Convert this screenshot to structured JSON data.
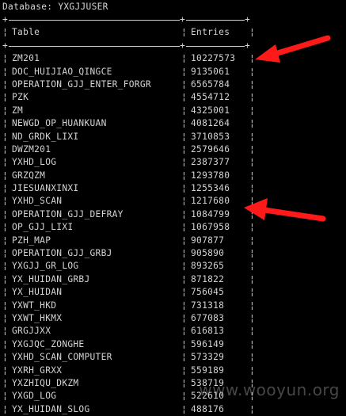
{
  "console": {
    "database_label": "Database: YXGJJUSER"
  },
  "table": {
    "headers": {
      "table": "Table",
      "entries": "Entries"
    },
    "rows": [
      {
        "table": "ZM201",
        "entries": "10227573"
      },
      {
        "table": "DOC_HUIJIAO_QINGCE",
        "entries": "9135061"
      },
      {
        "table": "OPERATION_GJJ_ENTER_FORGR",
        "entries": "6565784"
      },
      {
        "table": "PZK",
        "entries": "4554712"
      },
      {
        "table": "ZM",
        "entries": "4325001"
      },
      {
        "table": "NEWGD_OP_HUANKUAN",
        "entries": "4081264"
      },
      {
        "table": "ND_GRDK_LIXI",
        "entries": "3710853"
      },
      {
        "table": "DWZM201",
        "entries": "2579646"
      },
      {
        "table": "YXHD_LOG",
        "entries": "2387377"
      },
      {
        "table": "GRZQZM",
        "entries": "1293780"
      },
      {
        "table": "JIESUANXINXI",
        "entries": "1255346"
      },
      {
        "table": "YXHD_SCAN",
        "entries": "1217680"
      },
      {
        "table": "OPERATION_GJJ_DEFRAY",
        "entries": "1084799"
      },
      {
        "table": "OP_GJJ_LIXI",
        "entries": "1067958"
      },
      {
        "table": "PZH_MAP",
        "entries": "907877"
      },
      {
        "table": "OPERATION_GJJ_GRBJ",
        "entries": "905890"
      },
      {
        "table": "YXGJJ_GR_LOG",
        "entries": "893265"
      },
      {
        "table": "YX_HUIDAN_GRBJ",
        "entries": "871822"
      },
      {
        "table": "YX_HUIDAN",
        "entries": "756045"
      },
      {
        "table": "YXWT_HKD",
        "entries": "731318"
      },
      {
        "table": "YXWT_HKMX",
        "entries": "677083"
      },
      {
        "table": "GRGJJXX",
        "entries": "616813"
      },
      {
        "table": "YXGJQC_ZONGHE",
        "entries": "596149"
      },
      {
        "table": "YXHD_SCAN_COMPUTER",
        "entries": "573329"
      },
      {
        "table": "YXRH_GRXX",
        "entries": "559189"
      },
      {
        "table": "YXZHIQU_DKZM",
        "entries": "538719"
      },
      {
        "table": "YXGD_LOG",
        "entries": "522610"
      },
      {
        "table": "YX_HUIDAN_SLOG",
        "entries": "488176"
      }
    ]
  },
  "annotations": {
    "arrow_color": "#ff1a1a",
    "arrow_icon": "red-arrow-icon"
  },
  "watermark": {
    "text": "www.wooyun.org"
  },
  "colors": {
    "background": "#000000",
    "text": "#d4d4d4"
  }
}
